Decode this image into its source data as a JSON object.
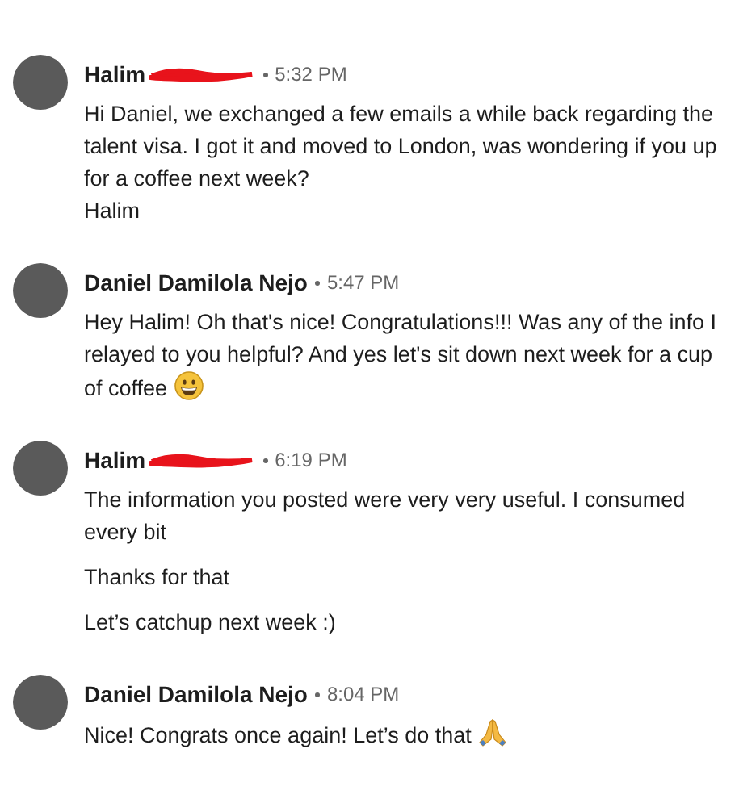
{
  "messages": [
    {
      "sender": "Halim",
      "redacted": true,
      "time": "5:32 PM",
      "paragraphs": [
        "Hi Daniel, we exchanged a few emails a while back regarding the talent visa. I got it and moved to London, was wondering if you up for a coffee next week?\nHalim"
      ],
      "kind": "plain"
    },
    {
      "sender": "Daniel Damilola Nejo",
      "time": "5:47 PM",
      "paragraphs": [
        "Hey Halim! Oh that's nice! Congratulations!!! Was any of the info I relayed to you helpful? And yes let's sit down next week for a cup of coffee"
      ],
      "kind": "grin"
    },
    {
      "sender": "Halim",
      "redacted": true,
      "time": "6:19 PM",
      "paragraphs": [
        "The information you posted were very very useful. I consumed every bit",
        "Thanks for that",
        "Let’s catchup next week :)"
      ],
      "kind": "plain"
    },
    {
      "sender": "Daniel Damilola Nejo",
      "time": "8:04 PM",
      "paragraphs": [
        "Nice! Congrats once again! Let’s do that"
      ],
      "kind": "pray"
    }
  ]
}
